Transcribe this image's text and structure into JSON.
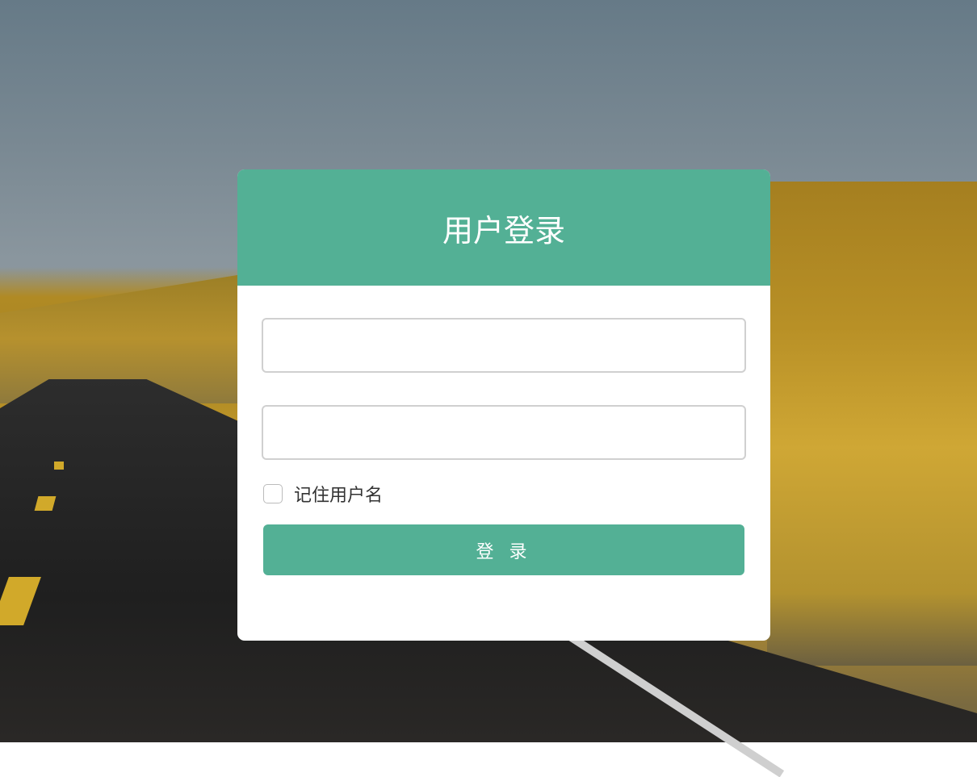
{
  "login": {
    "title": "用户登录",
    "username_value": "",
    "password_value": "",
    "remember_label": "记住用户名",
    "remember_checked": false,
    "submit_label": "登 录"
  },
  "colors": {
    "accent": "#53b095"
  }
}
